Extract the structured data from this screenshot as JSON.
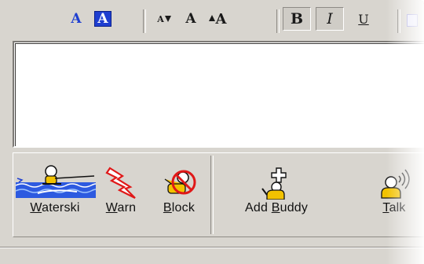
{
  "toolbar": {
    "text_color_glyph": "A",
    "bg_color_glyph": "A",
    "smaller_glyph": "A",
    "normal_glyph": "A",
    "larger_glyph": "A",
    "bold_glyph": "B",
    "italic_glyph": "I",
    "underline_glyph": "U"
  },
  "actions": {
    "waterski": {
      "u": "W",
      "rest": "aterski"
    },
    "warn": {
      "u": "W",
      "rest": "arn"
    },
    "block": {
      "pre": "",
      "u": "B",
      "rest": "lock"
    },
    "add_buddy": {
      "pre": "Add ",
      "u": "B",
      "rest": "uddy"
    },
    "talk": {
      "u": "T",
      "rest": "alk"
    }
  },
  "colors": {
    "window_bg": "#d8d5cf",
    "accent_blue": "#1f3fd0",
    "warn_red": "#e01818",
    "buddy_yellow": "#f2c200"
  },
  "icons": [
    "text-color-icon",
    "bg-color-icon",
    "font-smaller-icon",
    "font-normal-icon",
    "font-larger-icon",
    "bold-icon",
    "italic-icon",
    "underline-icon",
    "waterski-icon",
    "warn-icon",
    "block-icon",
    "add-buddy-icon",
    "talk-icon"
  ]
}
